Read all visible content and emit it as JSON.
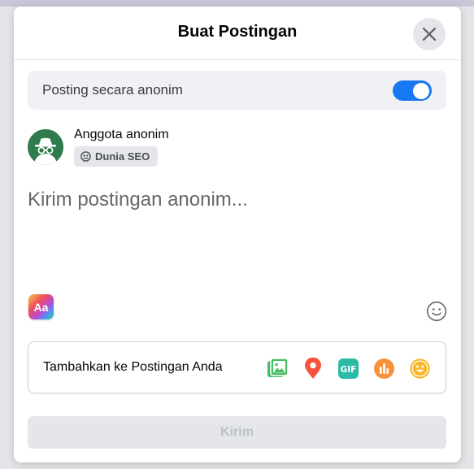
{
  "dialog": {
    "title": "Buat Postingan",
    "close_icon": "close-icon"
  },
  "anonymous": {
    "label": "Posting secara anonim",
    "enabled": true,
    "toggle_color": "#1877f2"
  },
  "author": {
    "name": "Anggota anonim",
    "avatar_icon": "incognito-icon",
    "avatar_color": "#2f7b4c",
    "group_icon": "group-icon",
    "group_name": "Dunia SEO"
  },
  "composer": {
    "placeholder": "Kirim postingan anonim...",
    "value": ""
  },
  "tools": {
    "text_format_icon": "text-format-icon",
    "text_format_label": "Aa",
    "emoji_icon": "emoji-icon"
  },
  "add_to_post": {
    "label": "Tambahkan ke Postingan Anda",
    "icons": [
      {
        "name": "photo-video-icon",
        "color": "#45bd62"
      },
      {
        "name": "location-icon",
        "color": "#f5533d"
      },
      {
        "name": "gif-icon",
        "color": "#2abba7",
        "label": "GIF"
      },
      {
        "name": "poll-icon",
        "color": "#f7923b"
      },
      {
        "name": "feeling-icon",
        "color": "#f7b928"
      }
    ]
  },
  "submit": {
    "label": "Kirim",
    "disabled": true
  }
}
